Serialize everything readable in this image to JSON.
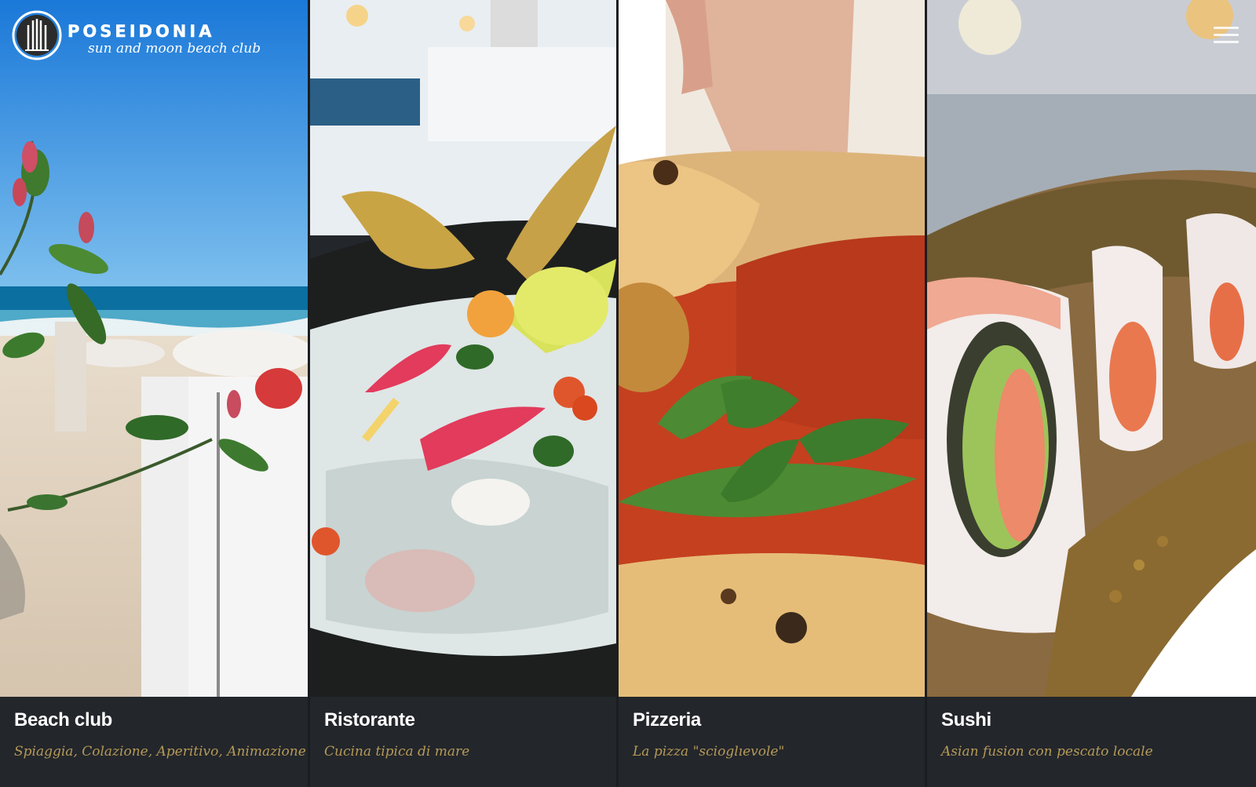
{
  "brand": {
    "name": "POSEIDONIA",
    "tagline": "sun and moon beach club"
  },
  "panels": [
    {
      "title": "Beach club",
      "subtitle": "Spiaggia, Colazione, Aperitivo, Animazione",
      "image": "beach-photo"
    },
    {
      "title": "Ristorante",
      "subtitle": "Cucina tipica di mare",
      "image": "raw-fish-dish-photo"
    },
    {
      "title": "Pizzeria",
      "subtitle": "La pizza \"scioglıevole\"",
      "image": "pizza-photo"
    },
    {
      "title": "Sushi",
      "subtitle": "Asian fusion con pescato locale",
      "image": "sushi-photo"
    }
  ],
  "icons": {
    "menu": "hamburger-menu-icon",
    "logo": "logo-mark-icon"
  },
  "colors": {
    "caption_bg": "#23262b",
    "subtitle": "#b59a58",
    "title": "#ffffff"
  }
}
